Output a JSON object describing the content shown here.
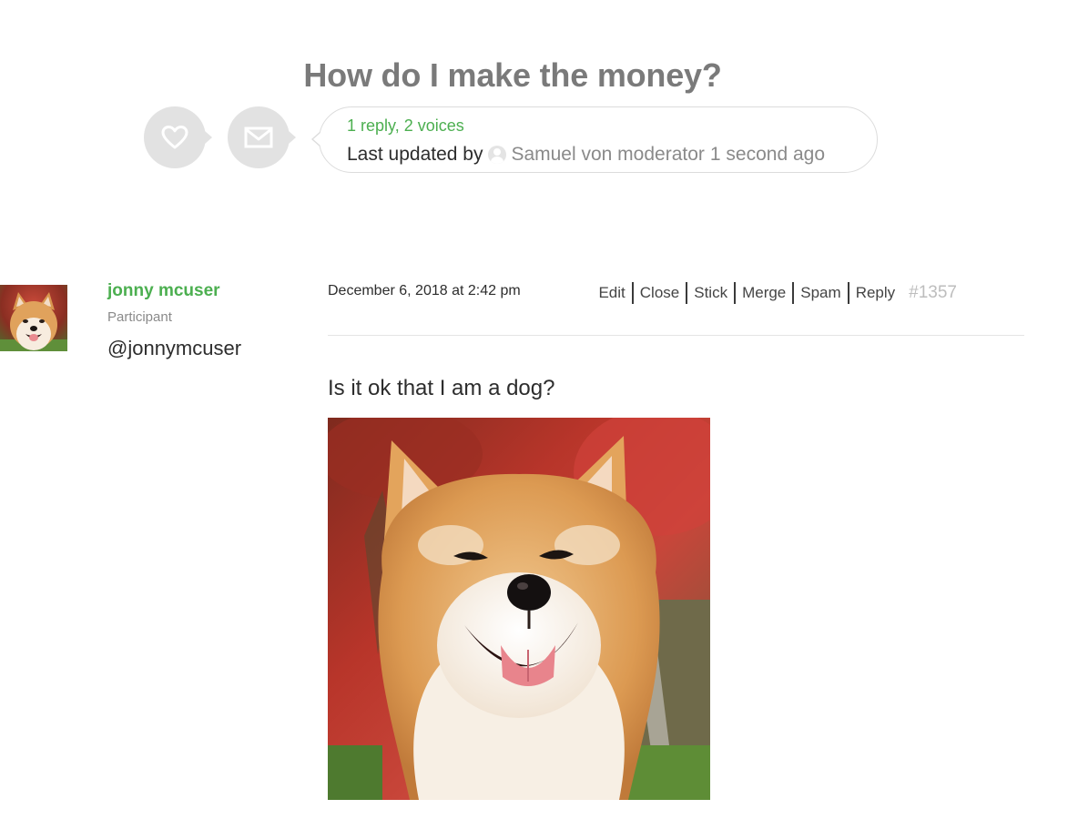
{
  "topic": {
    "title": "How do I make the money?",
    "favorite_icon": "heart-icon",
    "subscribe_icon": "envelope-icon",
    "meta": {
      "reply_count": "1 reply, 2 voices",
      "last_updated_prefix": "Last updated by",
      "last_updated_user": "Samuel von moderator",
      "freshness": "1 second ago"
    }
  },
  "reply": {
    "author": {
      "name": "jonny mcuser",
      "role": "Participant",
      "handle": "@jonnymcuser",
      "avatar": "shiba-dog-avatar"
    },
    "date": "December 6, 2018 at 2:42 pm",
    "admin_links": [
      "Edit",
      "Close",
      "Stick",
      "Merge",
      "Spam",
      "Reply"
    ],
    "permalink": "#1357",
    "content": "Is it ok that I am a dog?",
    "image": "shiba-dog-photo"
  },
  "colors": {
    "accent_green": "#4caf50",
    "title_gray": "#7a7a7a",
    "circle_gray": "#e2e2e2",
    "permalink_gray": "#bdbdbd"
  }
}
